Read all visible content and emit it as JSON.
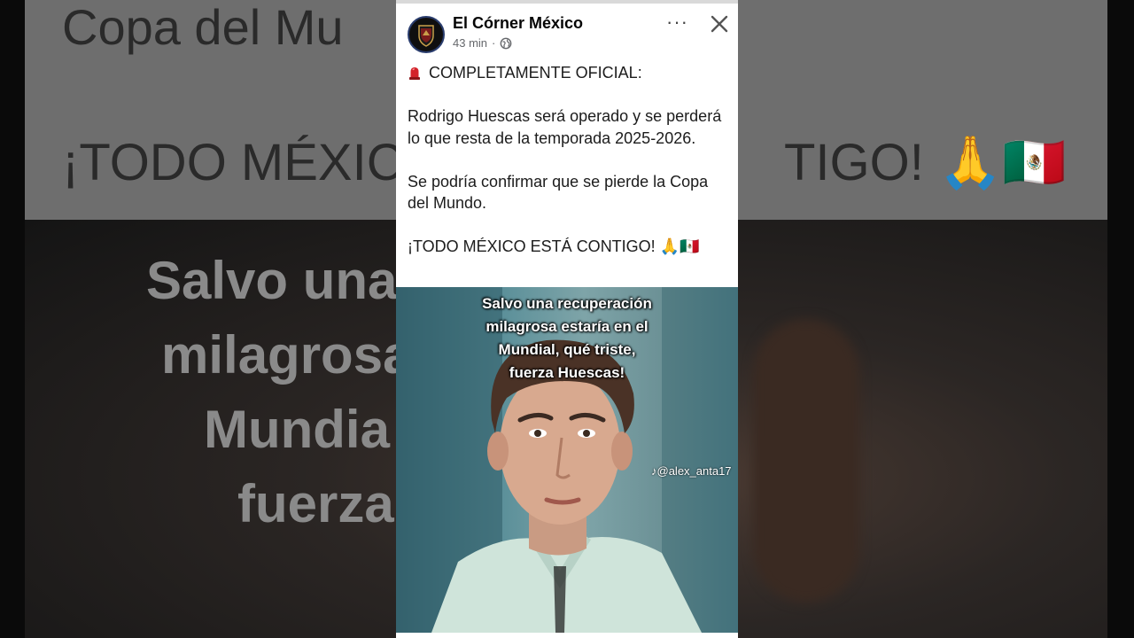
{
  "background": {
    "line1": "Copa del Mu",
    "line2_left": "¡TODO MÉXIC",
    "line2_right": "TIGO! 🙏🇲🇽",
    "caption_lines": [
      "Salvo una",
      "milagrosa",
      "Mundia",
      "fuerza"
    ]
  },
  "post": {
    "page_name": "El Córner México",
    "time": "43 min",
    "separator": "·",
    "more_label": "···",
    "text": {
      "line_official": "COMPLETAMENTE OFICIAL:",
      "para1": "Rodrigo Huescas será operado y se perderá lo que resta de la temporada 2025-2026.",
      "para2": "Se podría confirmar que se pierde la Copa del Mundo.",
      "para3": "¡TODO MÉXICO ESTÁ CONTIGO! 🙏🇲🇽"
    },
    "photo": {
      "caption": [
        "Salvo una recuperación",
        "milagrosa estaría en el",
        "Mundial, qué triste,",
        "fuerza Huescas!"
      ],
      "watermark": "@alex_anta17"
    }
  },
  "colors": {
    "name_text": "#050505",
    "meta_text": "#65676b",
    "siren_red": "#d3222a"
  }
}
